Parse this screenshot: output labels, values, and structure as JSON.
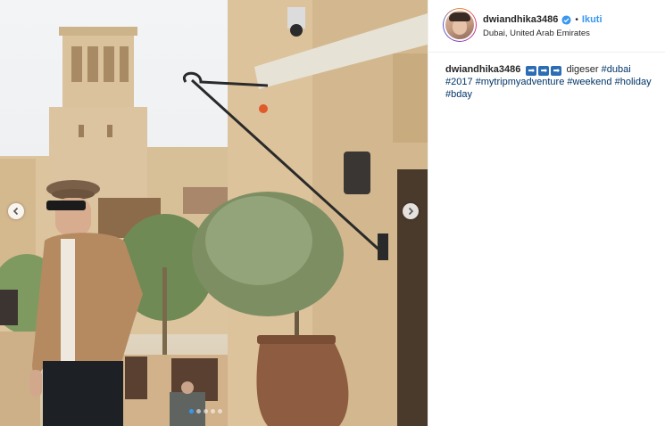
{
  "post": {
    "username": "dwiandhika3486",
    "verified": true,
    "separator": "•",
    "follow_label": "Ikuti",
    "location": "Dubai, United Arab Emirates",
    "caption": {
      "username": "dwiandhika3486",
      "emoji_glyph": "➡",
      "text": "digeser",
      "hashtags": [
        "#dubai",
        "#2017",
        "#mytripmyadventure",
        "#weekend",
        "#holiday",
        "#bday"
      ]
    }
  },
  "carousel": {
    "slide_count": 5,
    "active_slide": 1,
    "prev_icon": "chevron-left-icon",
    "next_icon": "chevron-right-icon"
  },
  "colors": {
    "accent": "#3897f0",
    "hashtag": "#003569",
    "text": "#262626"
  }
}
